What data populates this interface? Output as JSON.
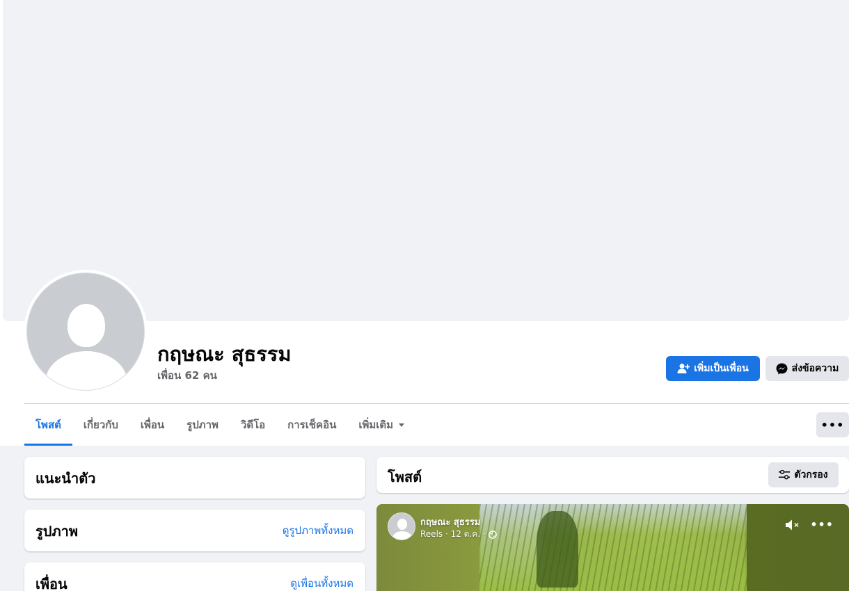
{
  "profile": {
    "name": "กฤษณะ สุธรรม",
    "friend_count": "เพื่อน 62 คน"
  },
  "actions": {
    "add_friend_label": "เพิ่มเป็นเพื่อน",
    "message_label": "ส่งข้อความ",
    "more_label": "•••"
  },
  "tabs": [
    {
      "label": "โพสต์",
      "active": true
    },
    {
      "label": "เกี่ยวกับ",
      "active": false
    },
    {
      "label": "เพื่อน",
      "active": false
    },
    {
      "label": "รูปภาพ",
      "active": false
    },
    {
      "label": "วิดีโอ",
      "active": false
    },
    {
      "label": "การเช็คอิน",
      "active": false
    },
    {
      "label": "เพิ่มเติม",
      "active": false
    }
  ],
  "left_column": {
    "intro": {
      "title": "แนะนำตัว"
    },
    "photos": {
      "title": "รูปภาพ",
      "link": "ดูรูปภาพทั้งหมด"
    },
    "friends": {
      "title": "เพื่อน",
      "link": "ดูเพื่อนทั้งหมด"
    }
  },
  "posts": {
    "title": "โพสต์",
    "filter_label": "ตัวกรอง"
  },
  "reel": {
    "author": "กฤษณะ สุธรรม",
    "meta": "Reels · 12 ต.ค. ·",
    "more_label": "•••"
  },
  "colors": {
    "accent": "#1b74e4",
    "background": "#f0f2f5",
    "secondary_button": "#e4e6eb",
    "muted_text": "#65676b"
  },
  "icons": {
    "add_friend": "add-friend-icon",
    "messenger": "messenger-icon",
    "filter": "filter-icon",
    "mute": "mute-icon",
    "globe": "globe-icon"
  }
}
